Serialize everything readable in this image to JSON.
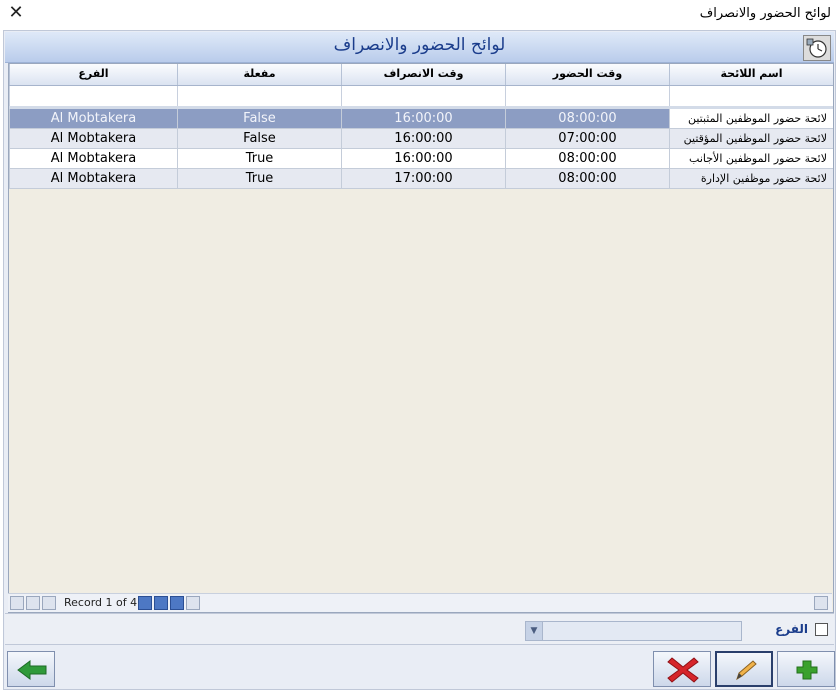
{
  "window": {
    "title": "لوائح الحضور والانصراف"
  },
  "header": {
    "title": "لوائح الحضور والانصراف"
  },
  "grid": {
    "columns": [
      "اسم اللائحة",
      "وقت الحضور",
      "وقت الانصراف",
      "مفعلة",
      "الفرع"
    ],
    "rows": [
      {
        "name": "لائحة حضور الموظفين المثبتين",
        "check_in": "08:00:00",
        "check_out": "16:00:00",
        "active": "False",
        "branch": "Al Mobtakera"
      },
      {
        "name": "لائحة حضور الموظفين المؤقتين",
        "check_in": "07:00:00",
        "check_out": "16:00:00",
        "active": "False",
        "branch": "Al Mobtakera"
      },
      {
        "name": "لائحة حضور الموظفين الأجانب",
        "check_in": "08:00:00",
        "check_out": "16:00:00",
        "active": "True",
        "branch": "Al Mobtakera"
      },
      {
        "name": "لائحة حضور موظفين الإدارة",
        "check_in": "08:00:00",
        "check_out": "17:00:00",
        "active": "True",
        "branch": "Al Mobtakera"
      }
    ],
    "selected_row": 0
  },
  "navigator": {
    "record_text": "Record 1 of 4"
  },
  "filter": {
    "branch_label": "الفرع"
  },
  "icons": {
    "close": "close-icon",
    "header": "clock-icon",
    "back": "arrow-left-icon",
    "delete": "x-icon",
    "edit": "pencil-icon",
    "add": "plus-icon"
  },
  "colors": {
    "selected_row": "#8c9dc3",
    "header_title": "#1b3d8c",
    "delete": "#d6252b",
    "add": "#3aa12d",
    "back": "#2f9a3a"
  }
}
